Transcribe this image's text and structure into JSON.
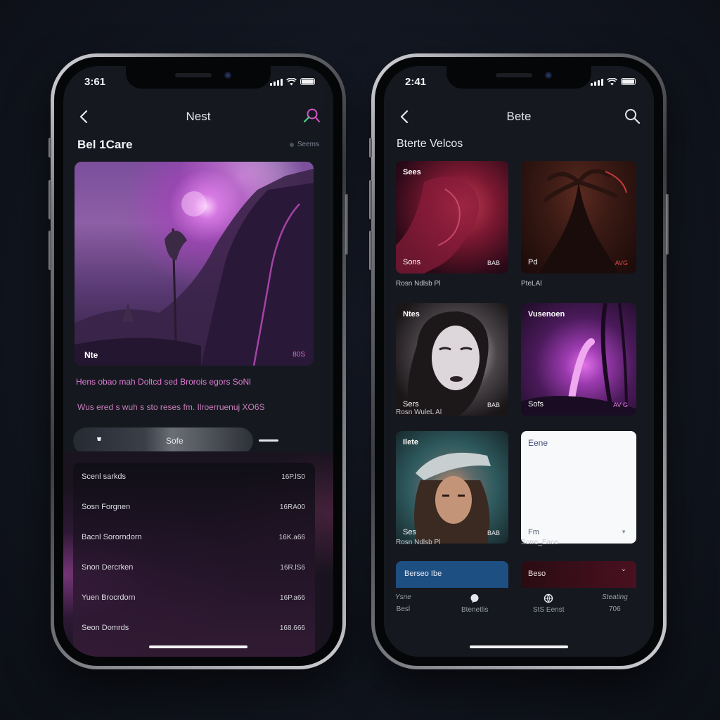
{
  "left_phone": {
    "status": {
      "time": "3:61"
    },
    "nav": {
      "title": "Nest"
    },
    "section": {
      "title": "Bel 1Care",
      "meta": "Seems"
    },
    "hero": {
      "caption": "Nte",
      "tag": "80S"
    },
    "description": {
      "line1": "Hens obao mah Doltcd sed Brorois egors SoNl",
      "line2": "Wus ered s wuh s sto reses fm. Ilroerruenuj XO6S"
    },
    "tab": {
      "label": "Sofe"
    },
    "list": [
      {
        "label": "Scenl sarkds",
        "value": "16P.lS0"
      },
      {
        "label": "Sosn Forgnen",
        "value": "16RA00"
      },
      {
        "label": "Bacnl Sororndorn",
        "value": "16K.a66"
      },
      {
        "label": "Snon Dercrken",
        "value": "16R.lS6"
      },
      {
        "label": "Yuen Brocrdorn",
        "value": "16P.a66"
      },
      {
        "label": "Seon Domrds",
        "value": "168.666"
      }
    ]
  },
  "right_phone": {
    "status": {
      "time": "2:41"
    },
    "nav": {
      "title": "Bete"
    },
    "section": {
      "title": "Bterte Velcos"
    },
    "tiles": [
      {
        "top": "Sees",
        "bottom": "Sons",
        "badge": "BAB",
        "caption": "Rosn Ndlsb Pl"
      },
      {
        "top": "",
        "bottom": "Pd",
        "badge": "AVG",
        "caption": "PteLAl"
      },
      {
        "top": "Ntes",
        "bottom": "Sers",
        "badge": "BAB",
        "caption": "Rosn WuleL Al"
      },
      {
        "top": "Vusenoen",
        "bottom": "Sofs",
        "badge": "AV G",
        "caption": ""
      },
      {
        "top": "Ilete",
        "bottom": "Ses",
        "badge": "BAB",
        "caption": "Rosn Ndlsb Pl"
      },
      {
        "top": "Eene",
        "bottom": "Fm",
        "badge": "",
        "caption": "Sorre_Eace"
      }
    ],
    "cards": [
      {
        "label": "Berseo Ibe"
      },
      {
        "label": "Beso"
      }
    ],
    "tabbar": [
      {
        "top": "Ysne",
        "label": "Besl"
      },
      {
        "top": "",
        "label": "Btenetlis"
      },
      {
        "top": "",
        "label": "StS Eenst"
      },
      {
        "top": "Steating",
        "label": "706"
      }
    ]
  },
  "colors": {
    "background": "#121620",
    "screen": "#15191f",
    "accent_pink": "#e07ad5",
    "accent_blue": "#1e4f82"
  }
}
